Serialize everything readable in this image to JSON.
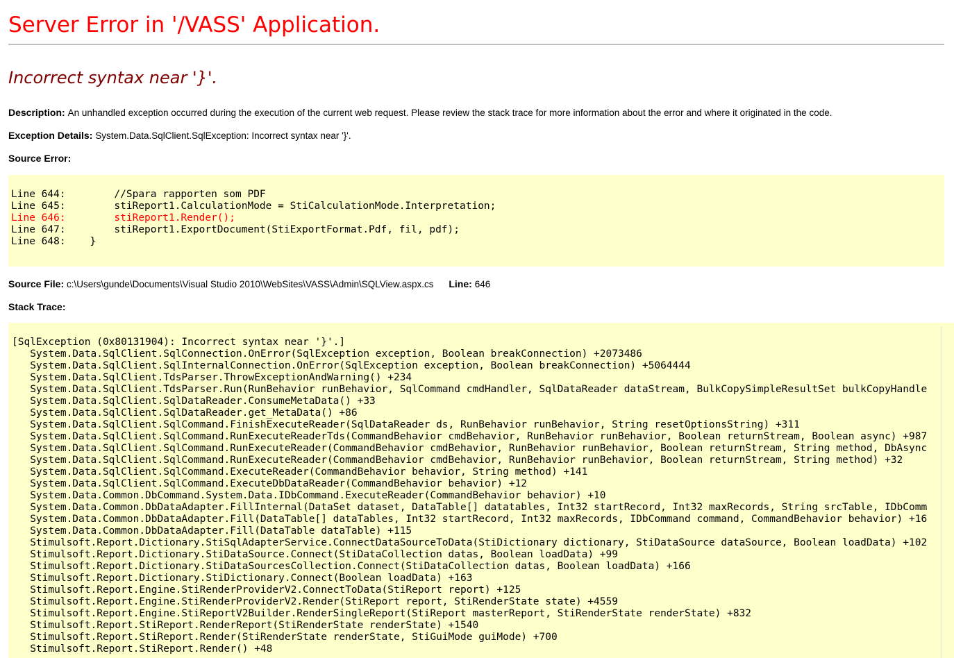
{
  "page_title": "Server Error in '/VASS' Application.",
  "error_heading": "Incorrect syntax near '}'.",
  "description": {
    "label": "Description:",
    "text": "An unhandled exception occurred during the execution of the current web request. Please review the stack trace for more information about the error and where it originated in the code."
  },
  "exception_details": {
    "label": "Exception Details:",
    "text": "System.Data.SqlClient.SqlException: Incorrect syntax near '}'."
  },
  "source_error": {
    "label": "Source Error:",
    "lines": [
      {
        "text": "Line 644:        //Spara rapporten som PDF",
        "error": false
      },
      {
        "text": "Line 645:        stiReport1.CalculationMode = StiCalculationMode.Interpretation;",
        "error": false
      },
      {
        "text": "Line 646:        stiReport1.Render();",
        "error": true
      },
      {
        "text": "Line 647:        stiReport1.ExportDocument(StiExportFormat.Pdf, fil, pdf);",
        "error": false
      },
      {
        "text": "Line 648:    }",
        "error": false
      }
    ]
  },
  "source_file": {
    "label": "Source File:",
    "path": "c:\\Users\\gunde\\Documents\\Visual Studio 2010\\WebSites\\VASS\\Admin\\SQLView.aspx.cs",
    "line_label": "Line:",
    "line_value": "646"
  },
  "stack_trace": {
    "label": "Stack Trace:",
    "lines": [
      "[SqlException (0x80131904): Incorrect syntax near '}'.]",
      "   System.Data.SqlClient.SqlConnection.OnError(SqlException exception, Boolean breakConnection) +2073486",
      "   System.Data.SqlClient.SqlInternalConnection.OnError(SqlException exception, Boolean breakConnection) +5064444",
      "   System.Data.SqlClient.TdsParser.ThrowExceptionAndWarning() +234",
      "   System.Data.SqlClient.TdsParser.Run(RunBehavior runBehavior, SqlCommand cmdHandler, SqlDataReader dataStream, BulkCopySimpleResultSet bulkCopyHandle",
      "   System.Data.SqlClient.SqlDataReader.ConsumeMetaData() +33",
      "   System.Data.SqlClient.SqlDataReader.get_MetaData() +86",
      "   System.Data.SqlClient.SqlCommand.FinishExecuteReader(SqlDataReader ds, RunBehavior runBehavior, String resetOptionsString) +311",
      "   System.Data.SqlClient.SqlCommand.RunExecuteReaderTds(CommandBehavior cmdBehavior, RunBehavior runBehavior, Boolean returnStream, Boolean async) +987",
      "   System.Data.SqlClient.SqlCommand.RunExecuteReader(CommandBehavior cmdBehavior, RunBehavior runBehavior, Boolean returnStream, String method, DbAsync",
      "   System.Data.SqlClient.SqlCommand.RunExecuteReader(CommandBehavior cmdBehavior, RunBehavior runBehavior, Boolean returnStream, String method) +32",
      "   System.Data.SqlClient.SqlCommand.ExecuteReader(CommandBehavior behavior, String method) +141",
      "   System.Data.SqlClient.SqlCommand.ExecuteDbDataReader(CommandBehavior behavior) +12",
      "   System.Data.Common.DbCommand.System.Data.IDbCommand.ExecuteReader(CommandBehavior behavior) +10",
      "   System.Data.Common.DbDataAdapter.FillInternal(DataSet dataset, DataTable[] datatables, Int32 startRecord, Int32 maxRecords, String srcTable, IDbComm",
      "   System.Data.Common.DbDataAdapter.Fill(DataTable[] dataTables, Int32 startRecord, Int32 maxRecords, IDbCommand command, CommandBehavior behavior) +16",
      "   System.Data.Common.DbDataAdapter.Fill(DataTable dataTable) +115",
      "   Stimulsoft.Report.Dictionary.StiSqlAdapterService.ConnectDataSourceToData(StiDictionary dictionary, StiDataSource dataSource, Boolean loadData) +102",
      "   Stimulsoft.Report.Dictionary.StiDataSource.Connect(StiDataCollection datas, Boolean loadData) +99",
      "   Stimulsoft.Report.Dictionary.StiDataSourcesCollection.Connect(StiDataCollection datas, Boolean loadData) +166",
      "   Stimulsoft.Report.Dictionary.StiDictionary.Connect(Boolean loadData) +163",
      "   Stimulsoft.Report.Engine.StiRenderProviderV2.ConnectToData(StiReport report) +125",
      "   Stimulsoft.Report.Engine.StiRenderProviderV2.Render(StiReport report, StiRenderState state) +4559",
      "   Stimulsoft.Report.Engine.StiReportV2Builder.RenderSingleReport(StiReport masterReport, StiRenderState renderState) +832",
      "   Stimulsoft.Report.StiReport.RenderReport(StiRenderState renderState) +1540",
      "   Stimulsoft.Report.StiReport.Render(StiRenderState renderState, StiGuiMode guiMode) +700",
      "   Stimulsoft.Report.StiReport.Render() +48"
    ]
  }
}
